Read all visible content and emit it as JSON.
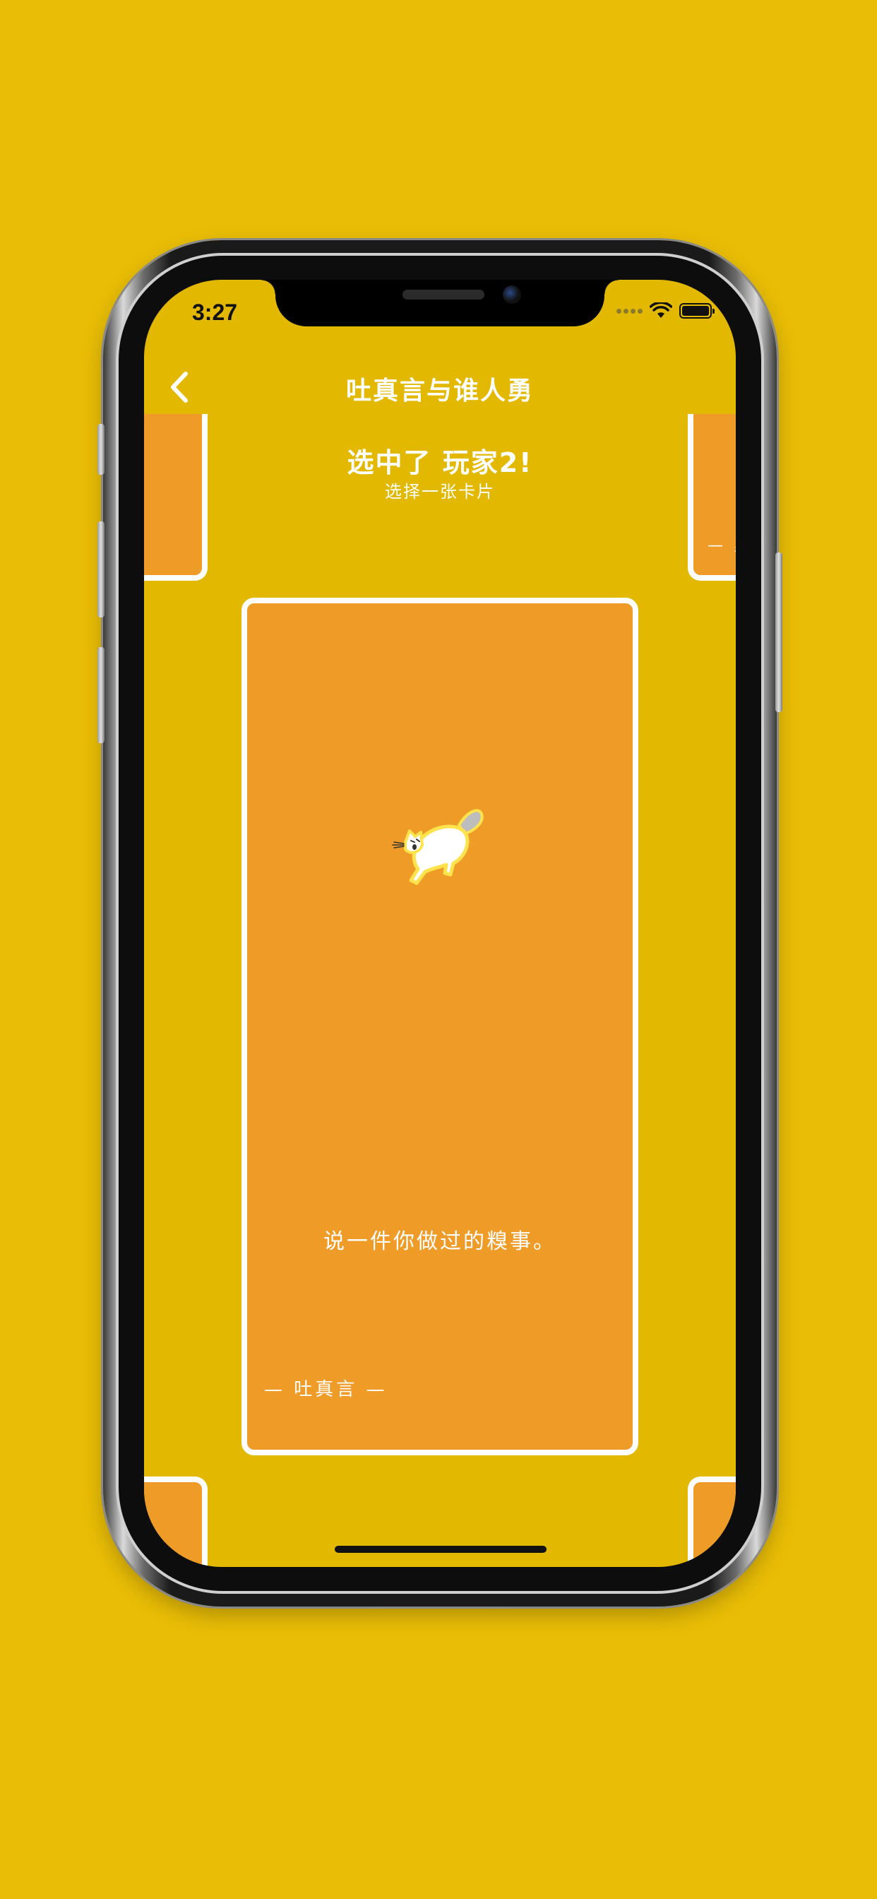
{
  "status_bar": {
    "time": "3:27",
    "icons": [
      "cellular-signal-icon",
      "wifi-icon",
      "battery-icon"
    ]
  },
  "nav": {
    "back_icon": "chevron-left-icon",
    "title": "吐真言与谁人勇"
  },
  "header": {
    "headline": "选中了 玩家2!",
    "subtitle": "选择一张卡片"
  },
  "main_card": {
    "illustration": "cat-icon",
    "prompt": "说一件你做过的糗事。",
    "tag": "— 吐真言 —"
  },
  "side_cards": {
    "top_right_tag": "— 勇"
  },
  "colors": {
    "background": "#E9BD06",
    "screen": "#E2B800",
    "card": "#EF9B28",
    "card_border": "#FFFFFF",
    "text": "#FFFFFF"
  }
}
